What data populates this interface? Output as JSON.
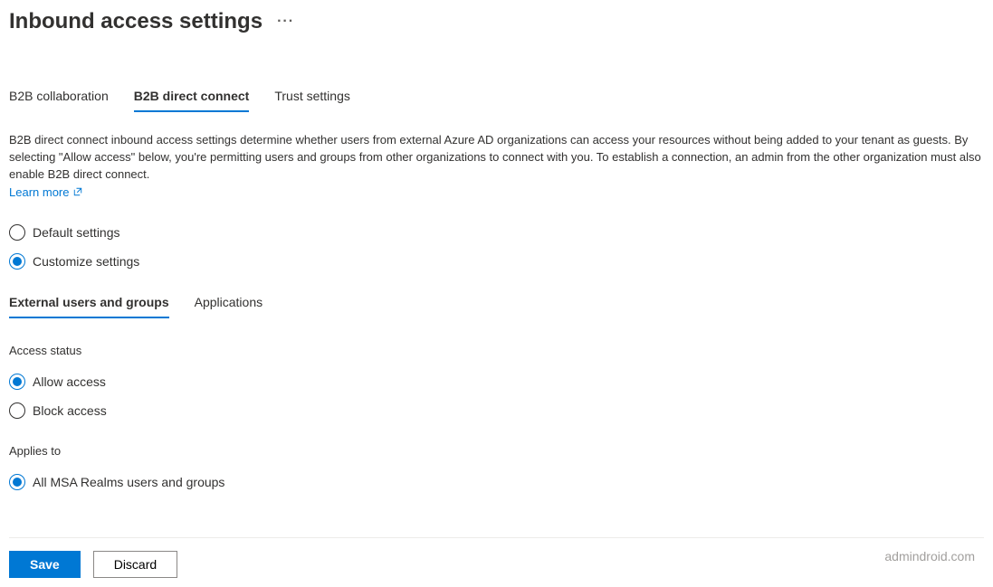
{
  "header": {
    "title": "Inbound access settings"
  },
  "tabs": [
    {
      "label": "B2B collaboration",
      "active": false
    },
    {
      "label": "B2B direct connect",
      "active": true
    },
    {
      "label": "Trust settings",
      "active": false
    }
  ],
  "description": "B2B direct connect inbound access settings determine whether users from external Azure AD organizations can access your resources without being added to your tenant as guests. By selecting \"Allow access\" below, you're permitting users and groups from other organizations to connect with you. To establish a connection, an admin from the other organization must also enable B2B direct connect.",
  "learn_more": "Learn more",
  "settings_mode": {
    "options": [
      {
        "label": "Default settings",
        "selected": false
      },
      {
        "label": "Customize settings",
        "selected": true
      }
    ]
  },
  "sub_tabs": [
    {
      "label": "External users and groups",
      "active": true
    },
    {
      "label": "Applications",
      "active": false
    }
  ],
  "access_status": {
    "label": "Access status",
    "options": [
      {
        "label": "Allow access",
        "selected": true
      },
      {
        "label": "Block access",
        "selected": false
      }
    ]
  },
  "applies_to": {
    "label": "Applies to",
    "options": [
      {
        "label": "All MSA Realms users and groups",
        "selected": true
      }
    ]
  },
  "footer": {
    "save": "Save",
    "discard": "Discard"
  },
  "watermark": "admindroid.com"
}
